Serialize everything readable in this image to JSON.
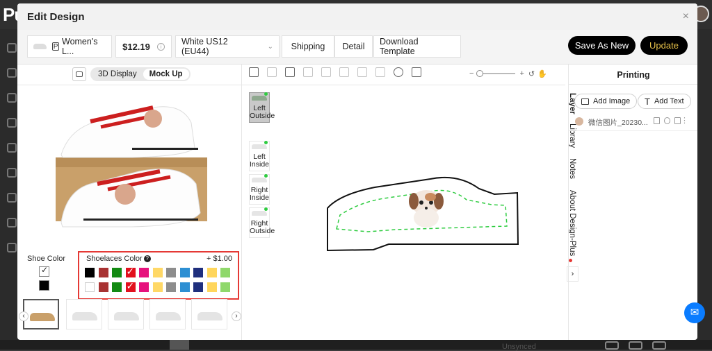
{
  "background": {
    "logo": "Pu",
    "status": "Unsynced"
  },
  "modal": {
    "title": "Edit Design",
    "close": "×"
  },
  "toolbar": {
    "product_icon": "P",
    "product_name": "Women's L...",
    "price": "$12.19",
    "variant": "White US12 (EU44)",
    "shipping": "Shipping",
    "detail": "Detail",
    "download": "Download Template",
    "save_new": "Save As New",
    "update": "Update"
  },
  "view_toggle": {
    "display": "3D Display",
    "mockup": "Mock Up",
    "active": "Mock Up"
  },
  "shoe_color": {
    "label": "Shoe Color",
    "colors": [
      "#ffffff",
      "#000000"
    ],
    "selected": "#ffffff"
  },
  "shoelaces": {
    "label": "Shoelaces Color",
    "help": "?",
    "price": "+ $1.00",
    "colors_row1": [
      "#000000",
      "#a83232",
      "#138a13",
      "#e2101d",
      "#e6127d",
      "#ffd866",
      "#8d8d8d",
      "#2d8fd3",
      "#1f2f7d",
      "#ffd65c",
      "#8fd86b"
    ],
    "colors_row2": [
      "#ffffff",
      "#a83232",
      "#138a13",
      "#e2101d",
      "#e6127d",
      "#ffd866",
      "#8d8d8d",
      "#2d8fd3",
      "#1f2f7d",
      "#ffd65c",
      "#8fd86b"
    ],
    "selected_index": 3
  },
  "parts": [
    {
      "label": "Left Outside",
      "active": true
    },
    {
      "label": "Left Inside",
      "active": false
    },
    {
      "label": "Right Inside",
      "active": false
    },
    {
      "label": "Right Outside",
      "active": false
    }
  ],
  "side_tabs": [
    "Layer",
    "Library",
    "Notes",
    "About Design-Plus"
  ],
  "printing": {
    "title": "Printing",
    "add_image": "Add Image",
    "add_text": "Add Text",
    "layer_name": "微信图片_20230..."
  },
  "zoom": {
    "minus": "−",
    "plus": "+"
  },
  "icons": [
    "close-icon",
    "camera-icon",
    "undo-icon",
    "redo-icon",
    "grid-icon",
    "align-icon",
    "zoom-in-icon",
    "zoom-out-icon",
    "hand-icon",
    "image-icon",
    "text-icon",
    "trash-icon",
    "eye-icon",
    "lock-icon",
    "drag-icon",
    "chevron-right-icon",
    "messenger-icon"
  ]
}
